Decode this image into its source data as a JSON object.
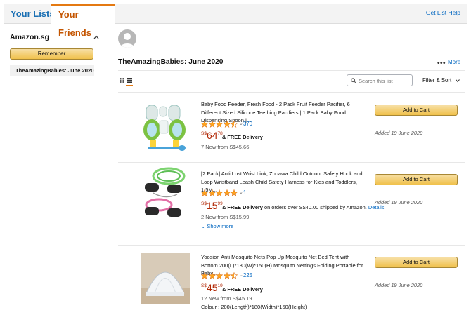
{
  "tabs": {
    "your_lists": "Your Lists",
    "your_friends": "Your Friends",
    "help": "Get List Help"
  },
  "sidebar": {
    "store": "Amazon.sg",
    "remember_label": "Remember",
    "items": [
      "TheAmazingBabies: June 2020"
    ]
  },
  "list": {
    "title": "TheAmazingBabies: June 2020",
    "more_label": "More"
  },
  "search": {
    "placeholder": "Search this list"
  },
  "filter": {
    "label": "Filter & Sort"
  },
  "items": [
    {
      "title": "Baby Food Feeder, Fresh Food - 2 Pack Fruit Feeder Pacifier, 6 Different Sized Silicone Teething Pacifiers | 1 Pack Baby Food Dispensing Spoon |...",
      "rating": 4.5,
      "rating_count": "370",
      "price_currency": "S$",
      "price_whole": "64",
      "price_fraction": "78",
      "delivery": "& FREE Delivery",
      "delivery_rest": "",
      "delivery_link": "",
      "new_from": "7 New from S$45.66",
      "show_more": "",
      "colour": "",
      "cart_label": "Add to Cart",
      "added": "Added 19 June 2020"
    },
    {
      "title": "[2 Pack] Anti Lost Wrist Link, Zooawa Child Outdoor Safety Hook and Loop Wristband Leash Child Safety Harness for Kids and Toddlers, 1.5M...",
      "rating": 5,
      "rating_count": "1",
      "price_currency": "S$",
      "price_whole": "15",
      "price_fraction": "99",
      "delivery": "& FREE Delivery",
      "delivery_rest": " on orders over S$40.00 shipped by Amazon. ",
      "delivery_link": "Details",
      "new_from": "2 New from S$15.99",
      "show_more": "Show more",
      "colour": "",
      "cart_label": "Add to Cart",
      "added": "Added 19 June 2020"
    },
    {
      "title": "Yoosion Anti Mosquito Nets Pop Up Mosquito Net Bed Tent with Bottom 200(L)*180(W)*150(H) Mosquito Nettings Folding Portable for Baby...",
      "rating": 4.5,
      "rating_count": "225",
      "price_currency": "S$",
      "price_whole": "45",
      "price_fraction": "19",
      "delivery": "& FREE Delivery",
      "delivery_rest": "",
      "delivery_link": "",
      "new_from": "12 New from S$45.19",
      "show_more": "",
      "colour": "Colour : 200(Length)*180(Width)*150(Height)",
      "cart_label": "Add to Cart",
      "added": "Added 19 June 2020"
    }
  ],
  "colors": {
    "tab_active": "#c45500",
    "link": "#0066c0",
    "price": "#b12704",
    "star": "#ffa41c",
    "button": "#f0c14b"
  },
  "icons": [
    "chevron-up-icon",
    "avatar-icon",
    "more-dots-icon",
    "grid-view-icon",
    "list-view-icon",
    "search-icon",
    "chevron-down-icon",
    "star-icon"
  ]
}
